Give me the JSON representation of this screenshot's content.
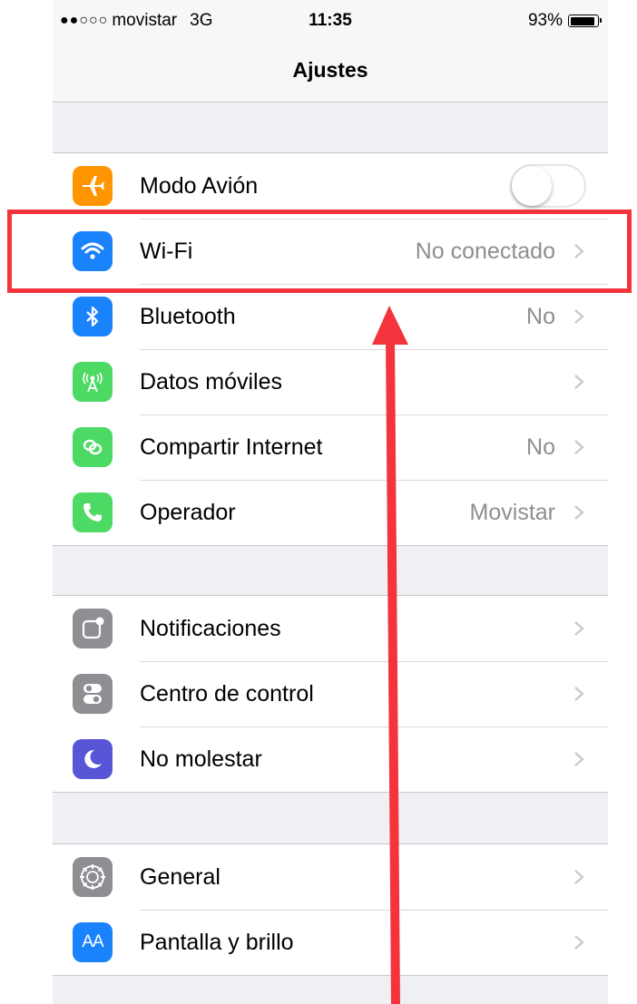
{
  "status_bar": {
    "signal_dots": "●●○○○",
    "carrier": "movistar",
    "network": "3G",
    "time": "11:35",
    "battery_percent": "93%",
    "battery_level": 0.93
  },
  "nav": {
    "title": "Ajustes"
  },
  "groups": [
    {
      "rows": [
        {
          "label": "Modo Avión",
          "icon": "airplane-icon",
          "color": "#ff9500",
          "control": "toggle",
          "toggle_on": false
        },
        {
          "label": "Wi-Fi",
          "icon": "wifi-icon",
          "color": "#1a82fb",
          "detail": "No conectado"
        },
        {
          "label": "Bluetooth",
          "icon": "bluetooth-icon",
          "color": "#1a82fb",
          "detail": "No"
        },
        {
          "label": "Datos móviles",
          "icon": "antenna-icon",
          "color": "#4cd964",
          "detail": ""
        },
        {
          "label": "Compartir Internet",
          "icon": "hotspot-icon",
          "color": "#4cd964",
          "detail": "No"
        },
        {
          "label": "Operador",
          "icon": "phone-icon",
          "color": "#4cd964",
          "detail": "Movistar"
        }
      ]
    },
    {
      "rows": [
        {
          "label": "Notificaciones",
          "icon": "notifications-icon",
          "color": "#8e8e93",
          "detail": ""
        },
        {
          "label": "Centro de control",
          "icon": "control-center-icon",
          "color": "#8e8e93",
          "detail": ""
        },
        {
          "label": "No molestar",
          "icon": "moon-icon",
          "color": "#5856d6",
          "detail": ""
        }
      ]
    },
    {
      "rows": [
        {
          "label": "General",
          "icon": "gear-icon",
          "color": "#8e8e93",
          "detail": ""
        },
        {
          "label": "Pantalla y brillo",
          "icon": "display-brightness-icon",
          "color": "#1a82fb",
          "detail": "",
          "icon_text": "AA"
        }
      ]
    }
  ],
  "annotation": {
    "highlight_color": "#f4343c",
    "highlight_target": "Wi-Fi",
    "arrow_icon": "red-arrow-icon"
  }
}
